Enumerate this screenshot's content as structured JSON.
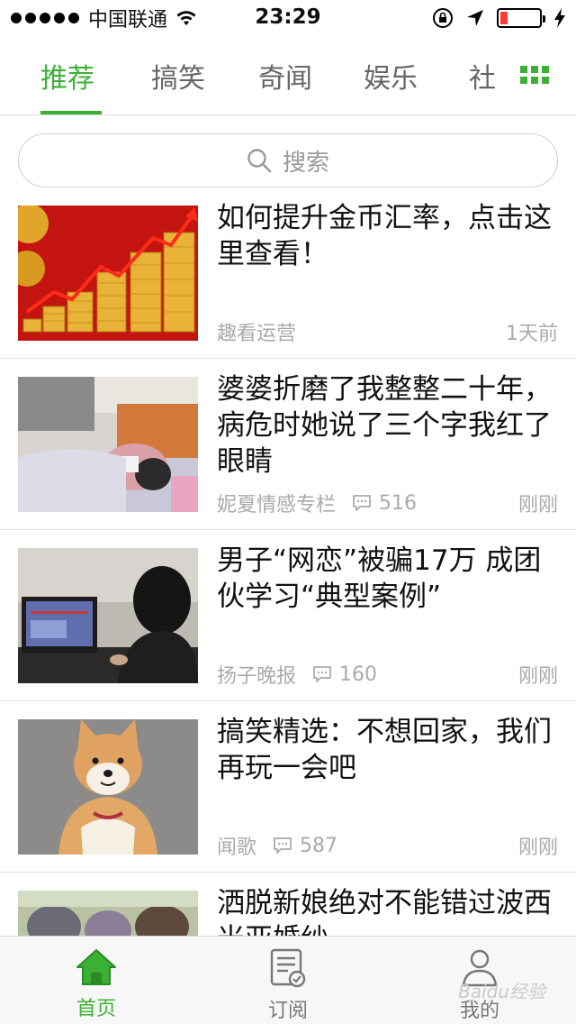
{
  "status_bar": {
    "carrier": "中国联通",
    "time": "23:29",
    "battery_level": 0.18
  },
  "tabs": [
    {
      "label": "推荐",
      "active": true
    },
    {
      "label": "搞笑",
      "active": false
    },
    {
      "label": "奇闻",
      "active": false
    },
    {
      "label": "娱乐",
      "active": false
    },
    {
      "label": "社",
      "active": false
    }
  ],
  "search": {
    "placeholder": "搜索"
  },
  "news": [
    {
      "title": "如何提升金币汇率，点击这里查看！",
      "source": "趣看运营",
      "comments": "",
      "time": "1天前",
      "thumb": "gold-coins"
    },
    {
      "title": "婆婆折磨了我整整二十年，病危时她说了三个字我红了眼睛",
      "source": "妮夏情感专栏",
      "comments": "516",
      "time": "刚刚",
      "thumb": "sick-woman"
    },
    {
      "title": "男子“网恋”被骗17万 成团伙学习“典型案例”",
      "source": "扬子晚报",
      "comments": "160",
      "time": "刚刚",
      "thumb": "man-computer"
    },
    {
      "title": "搞笑精选：不想回家，我们再玩一会吧",
      "source": "闻歌",
      "comments": "587",
      "time": "刚刚",
      "thumb": "shiba-dog"
    },
    {
      "title": "洒脱新娘绝对不能错过波西米亚婚纱",
      "source": "",
      "comments": "",
      "time": "",
      "thumb": "bride"
    }
  ],
  "bottom_nav": [
    {
      "label": "首页",
      "icon": "home-icon",
      "active": true
    },
    {
      "label": "订阅",
      "icon": "subscribe-icon",
      "active": false
    },
    {
      "label": "我的",
      "icon": "profile-icon",
      "active": false
    }
  ],
  "watermark": "Baidu经验",
  "colors": {
    "accent": "#3cb034",
    "muted": "#aaaaaa"
  }
}
